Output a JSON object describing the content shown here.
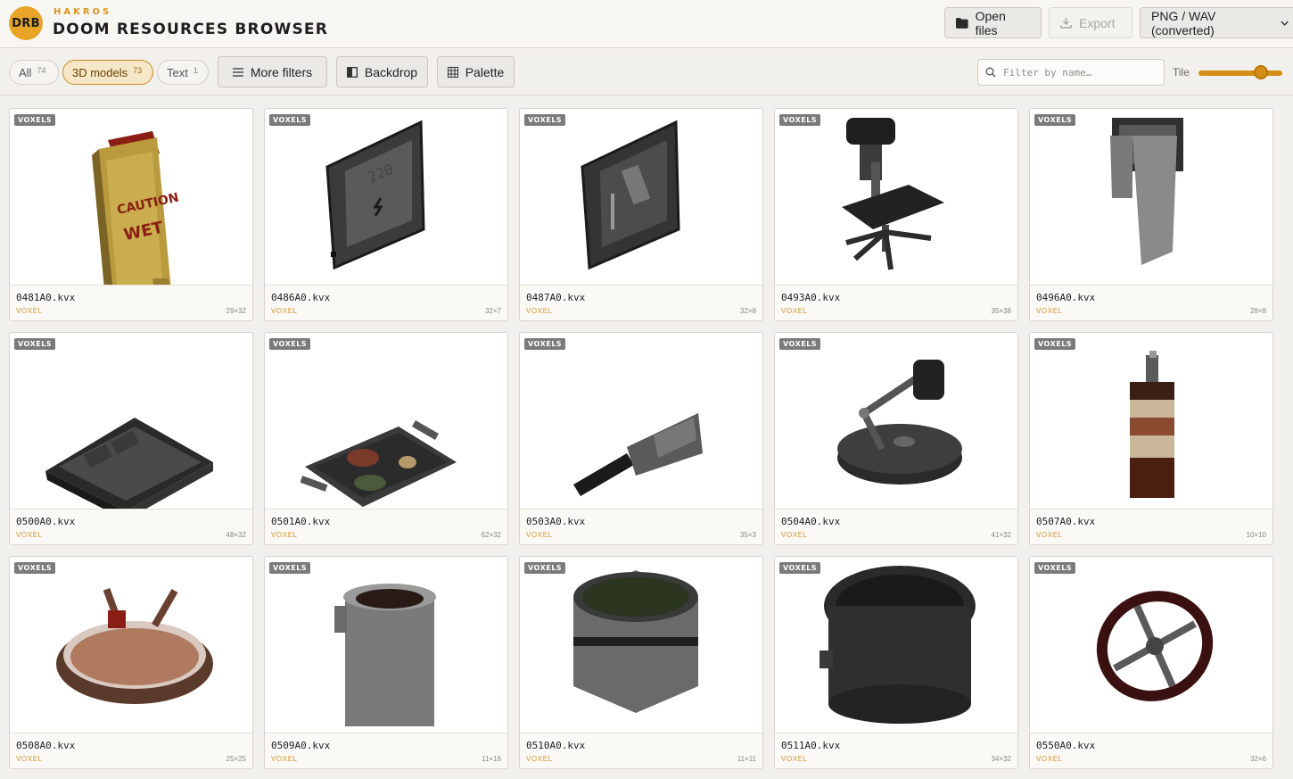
{
  "app": {
    "logo_text": "DRB",
    "brand_sub": "HAKROS",
    "title": "DOOM RESOURCES BROWSER"
  },
  "header": {
    "open_label": "Open files",
    "export_label": "Export",
    "format_label": "PNG / WAV (converted)"
  },
  "toolbar": {
    "chips": [
      {
        "label": "All",
        "count": "74"
      },
      {
        "label": "3D models",
        "count": "73"
      },
      {
        "label": "Text",
        "count": "1"
      }
    ],
    "more_filters_label": "More filters",
    "backdrop_label": "Backdrop",
    "palette_label": "Palette",
    "search_placeholder": "Filter by name…",
    "tile_label": "Tile",
    "tile_value": 0.75
  },
  "cards": [
    {
      "badge": "VOXELS",
      "name": "0481A0.kvx",
      "type": "VOXEL",
      "dims": "29×32",
      "art": "sign"
    },
    {
      "badge": "VOXELS",
      "name": "0486A0.kvx",
      "type": "VOXEL",
      "dims": "32×7",
      "art": "panel220"
    },
    {
      "badge": "VOXELS",
      "name": "0487A0.kvx",
      "type": "VOXEL",
      "dims": "32×8",
      "art": "panel"
    },
    {
      "badge": "VOXELS",
      "name": "0493A0.kvx",
      "type": "VOXEL",
      "dims": "35×38",
      "art": "chair"
    },
    {
      "badge": "VOXELS",
      "name": "0496A0.kvx",
      "type": "VOXEL",
      "dims": "28×8",
      "art": "towel"
    },
    {
      "badge": "VOXELS",
      "name": "0500A0.kvx",
      "type": "VOXEL",
      "dims": "48×32",
      "art": "tray"
    },
    {
      "badge": "VOXELS",
      "name": "0501A0.kvx",
      "type": "VOXEL",
      "dims": "62×32",
      "art": "foodtray"
    },
    {
      "badge": "VOXELS",
      "name": "0503A0.kvx",
      "type": "VOXEL",
      "dims": "35×3",
      "art": "knife"
    },
    {
      "badge": "VOXELS",
      "name": "0504A0.kvx",
      "type": "VOXEL",
      "dims": "41×32",
      "art": "lamp"
    },
    {
      "badge": "VOXELS",
      "name": "0507A0.kvx",
      "type": "VOXEL",
      "dims": "10×10",
      "art": "bottle"
    },
    {
      "badge": "VOXELS",
      "name": "0508A0.kvx",
      "type": "VOXEL",
      "dims": "25×25",
      "art": "bowl"
    },
    {
      "badge": "VOXELS",
      "name": "0509A0.kvx",
      "type": "VOXEL",
      "dims": "11×16",
      "art": "cup"
    },
    {
      "badge": "VOXELS",
      "name": "0510A0.kvx",
      "type": "VOXEL",
      "dims": "11×11",
      "art": "pot"
    },
    {
      "badge": "VOXELS",
      "name": "0511A0.kvx",
      "type": "VOXEL",
      "dims": "34×32",
      "art": "bigpot"
    },
    {
      "badge": "VOXELS",
      "name": "0550A0.kvx",
      "type": "VOXEL",
      "dims": "32×6",
      "art": "valve"
    }
  ]
}
